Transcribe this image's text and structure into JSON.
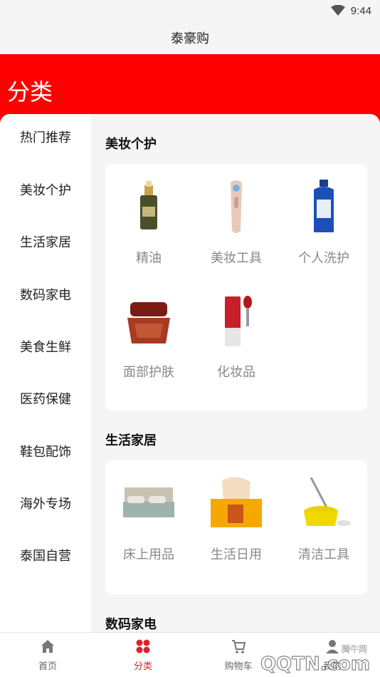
{
  "status_bar": {
    "time": "9:44"
  },
  "app_title": "泰豪购",
  "page_title": "分类",
  "sidebar": {
    "items": [
      {
        "label": "热门推荐"
      },
      {
        "label": "美妆个护"
      },
      {
        "label": "生活家居"
      },
      {
        "label": "数码家电"
      },
      {
        "label": "美食生鲜"
      },
      {
        "label": "医药保健"
      },
      {
        "label": "鞋包配饰"
      },
      {
        "label": "海外专场"
      },
      {
        "label": "泰国自营"
      }
    ]
  },
  "sections": [
    {
      "title": "美妆个护",
      "items": [
        {
          "label": "精油",
          "icon": "essential-oil-bottle-icon"
        },
        {
          "label": "美妆工具",
          "icon": "beauty-device-icon"
        },
        {
          "label": "个人洗护",
          "icon": "shampoo-bottle-icon"
        },
        {
          "label": "面部护肤",
          "icon": "face-cream-jar-icon"
        },
        {
          "label": "化妆品",
          "icon": "lip-gloss-icon"
        }
      ]
    },
    {
      "title": "生活家居",
      "items": [
        {
          "label": "床上用品",
          "icon": "bed-icon"
        },
        {
          "label": "生活日用",
          "icon": "tissue-box-icon"
        },
        {
          "label": "清洁工具",
          "icon": "mop-bucket-icon"
        }
      ]
    },
    {
      "title": "数码家电",
      "items": []
    }
  ],
  "bottom_nav": [
    {
      "label": "首页",
      "icon": "home-icon",
      "active": false
    },
    {
      "label": "分类",
      "icon": "category-icon",
      "active": true
    },
    {
      "label": "购物车",
      "icon": "cart-icon",
      "active": false
    },
    {
      "label": "我的",
      "icon": "user-icon",
      "active": false
    }
  ],
  "watermark": {
    "text": "QQTN.com",
    "subtext": "腾牛网"
  },
  "colors": {
    "brand_red": "#ff0000",
    "active_red": "#e0202a",
    "background": "#f5f5f5"
  }
}
